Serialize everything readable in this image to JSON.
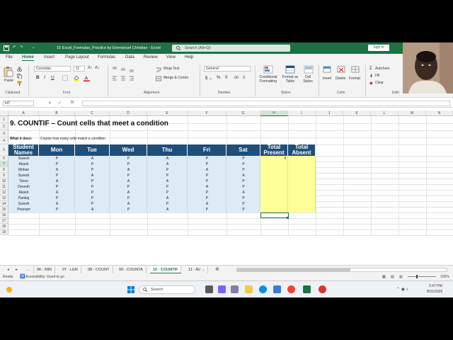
{
  "window": {
    "file_title": "15 Excel_Formulas_Practice by Emmanuel Christian  -  Excel",
    "search_placeholder": "Search (Alt+Q)",
    "sign_in": "Sign in"
  },
  "ribbon_tabs": [
    "File",
    "Home",
    "Insert",
    "Page Layout",
    "Formulas",
    "Data",
    "Review",
    "View",
    "Help"
  ],
  "ribbon": {
    "clipboard_label": "Clipboard",
    "paste_label": "Paste",
    "font_label": "Font",
    "font_name": "Consolas",
    "font_size": "11",
    "alignment_label": "Alignment",
    "wrap_text": "Wrap Text",
    "merge_center": "Merge & Center",
    "number_label": "Number",
    "number_format": "General",
    "styles_label": "Styles",
    "conditional_formatting": "Conditional Formatting",
    "format_as_table": "Format as Table",
    "cell_styles": "Cell Styles",
    "cells_label": "Cells",
    "insert": "Insert",
    "delete": "Delete",
    "format": "Format",
    "autosum": "AutoSum",
    "fill": "Fill",
    "clear": "Clear",
    "editing_label": "Editi"
  },
  "formula_bar": {
    "name_box": "H7",
    "fx": "fx",
    "formula": ""
  },
  "columns": [
    "A",
    "B",
    "C",
    "D",
    "E",
    "F",
    "G",
    "H",
    "I",
    "J",
    "K",
    "L",
    "M",
    "N",
    "O"
  ],
  "selected_column": "H",
  "selected_row": "7",
  "rows": [
    "1",
    "2",
    "3",
    "4",
    "5",
    "6",
    "7",
    "8",
    "9",
    "10",
    "11",
    "12",
    "13",
    "14",
    "15",
    "16",
    "17",
    "18",
    "19"
  ],
  "sheet": {
    "title": "9. COUNTIF – Count cells that meet a condition",
    "what_label": "What it does:",
    "what_text": "Counts how many cells match a condition",
    "headers": [
      "Student Names",
      "Mon",
      "Tue",
      "Wed",
      "Thu",
      "Fri",
      "Sat",
      "Total Present",
      "Total Absent"
    ],
    "students": [
      {
        "name": "Suresh",
        "days": [
          "P",
          "A",
          "P",
          "A",
          "P",
          "P"
        ],
        "present": "4",
        "absent": ""
      },
      {
        "name": "Akash",
        "days": [
          "P",
          "P",
          "P",
          "A",
          "P",
          "P"
        ],
        "present": "",
        "absent": ""
      },
      {
        "name": "Mohan",
        "days": [
          "A",
          "P",
          "A",
          "P",
          "A",
          "P"
        ],
        "present": "",
        "absent": ""
      },
      {
        "name": "Suresh",
        "days": [
          "P",
          "A",
          "P",
          "P",
          "P",
          "A"
        ],
        "present": "",
        "absent": ""
      },
      {
        "name": "Tarun",
        "days": [
          "A",
          "P",
          "A",
          "A",
          "P",
          "P"
        ],
        "present": "",
        "absent": ""
      },
      {
        "name": "Devesh",
        "days": [
          "P",
          "P",
          "P",
          "P",
          "A",
          "P"
        ],
        "present": "",
        "absent": ""
      },
      {
        "name": "Akash",
        "days": [
          "A",
          "P",
          "A",
          "P",
          "P",
          "A"
        ],
        "present": "",
        "absent": ""
      },
      {
        "name": "Pankaj",
        "days": [
          "P",
          "P",
          "P",
          "A",
          "P",
          "P"
        ],
        "present": "",
        "absent": ""
      },
      {
        "name": "Suresh",
        "days": [
          "A",
          "P",
          "A",
          "P",
          "A",
          "P"
        ],
        "present": "",
        "absent": ""
      },
      {
        "name": "Poonam",
        "days": [
          "P",
          "A",
          "P",
          "A",
          "P",
          "P"
        ],
        "present": "",
        "absent": ""
      }
    ]
  },
  "sheet_tabs": [
    "...",
    "06 - MIN",
    "07 - LEN",
    "08 - COUNT",
    "09 - COUNTA",
    "10 - COUNTIF",
    "11 - AV ..."
  ],
  "active_sheet": "10 - COUNTIF",
  "status": {
    "ready": "Ready",
    "accessibility": "Accessibility: Good to go",
    "zoom": "100%"
  },
  "taskbar": {
    "search": "Search",
    "time": "2:47 PM",
    "date": "8/31/2026"
  },
  "colors": {
    "excel_green": "#1e7145",
    "header_blue": "#1f4e79",
    "data_fill": "#ddebf7",
    "total_fill": "#ffff99"
  }
}
